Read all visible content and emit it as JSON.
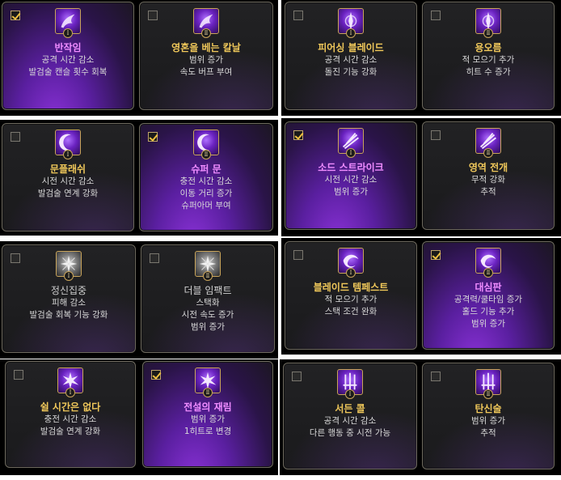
{
  "cards": [
    {
      "title": "반작임",
      "lines": [
        "공격 시간 감소",
        "발검술 캔슬 횟수 회복"
      ],
      "rank": "Ⅰ",
      "checked": true,
      "selected": true,
      "icon": "purple-wing-icon"
    },
    {
      "title": "영혼을 베는 칼날",
      "lines": [
        "범위 증가",
        "속도 버프 부여"
      ],
      "rank": "Ⅱ",
      "checked": false,
      "selected": false,
      "icon": "purple-wing-icon"
    },
    {
      "title": "피어싱 블레이드",
      "lines": [
        "공격 시간 감소",
        "돌진 기능 강화"
      ],
      "rank": "Ⅰ",
      "checked": false,
      "selected": false,
      "icon": "purple-blade-icon"
    },
    {
      "title": "용오름",
      "lines": [
        "적 모으기 추가",
        "히트 수 증가"
      ],
      "rank": "Ⅱ",
      "checked": false,
      "selected": false,
      "icon": "purple-blade-icon"
    },
    {
      "title": "문플래쉬",
      "lines": [
        "시전 시간 감소",
        "발검술 연계 강화"
      ],
      "rank": "Ⅰ",
      "checked": false,
      "selected": false,
      "icon": "crescent-moon-icon"
    },
    {
      "title": "슈퍼 문",
      "lines": [
        "충전 시간 감소",
        "이동 거리 증가",
        "슈퍼아머 부여"
      ],
      "rank": "Ⅱ",
      "checked": true,
      "selected": true,
      "icon": "crescent-moon-icon"
    },
    {
      "title": "소드 스트라이크",
      "lines": [
        "시전 시간 감소",
        "범위 증가"
      ],
      "rank": "Ⅰ",
      "checked": true,
      "selected": true,
      "icon": "sword-strike-icon"
    },
    {
      "title": "영역 전개",
      "lines": [
        "무적 강화",
        "추적"
      ],
      "rank": "Ⅱ",
      "checked": false,
      "selected": false,
      "icon": "sword-strike-icon"
    },
    {
      "title": "정신집중",
      "lines": [
        "피해 감소",
        "발검술 회복 기능 강화"
      ],
      "rank": "Ⅰ",
      "checked": false,
      "selected": false,
      "icon": "grey-star-icon"
    },
    {
      "title": "더블 임팩트",
      "lines": [
        "스택화",
        "시전 속도 증가",
        "범위 증가"
      ],
      "rank": "Ⅱ",
      "checked": false,
      "selected": false,
      "icon": "grey-star-icon"
    },
    {
      "title": "블레이드 템페스트",
      "lines": [
        "적 모으기 추가",
        "스택 조건 완화"
      ],
      "rank": "Ⅰ",
      "checked": false,
      "selected": false,
      "icon": "purple-tempest-icon"
    },
    {
      "title": "대심판",
      "lines": [
        "공격력/쿨타임 증가",
        "홀드 기능 추가",
        "범위 증가"
      ],
      "rank": "Ⅱ",
      "checked": true,
      "selected": true,
      "icon": "purple-tempest-icon"
    },
    {
      "title": "쉴 시간은 없다",
      "lines": [
        "충전 시간 감소",
        "발검술 연계 강화"
      ],
      "rank": "Ⅰ",
      "checked": false,
      "selected": false,
      "icon": "purple-burst-icon"
    },
    {
      "title": "전설의 재림",
      "lines": [
        "범위 증가",
        "1히트로 변경"
      ],
      "rank": "Ⅱ",
      "checked": true,
      "selected": true,
      "icon": "purple-burst-icon"
    },
    {
      "title": "서든 콜",
      "lines": [
        "공격 시간 감소",
        "다른 행동 중 시전 가능"
      ],
      "rank": "Ⅰ",
      "checked": false,
      "selected": false,
      "icon": "triple-sword-icon"
    },
    {
      "title": "탄신술",
      "lines": [
        "범위 증가",
        "추적"
      ],
      "rank": "Ⅱ",
      "checked": false,
      "selected": false,
      "icon": "triple-sword-icon"
    }
  ]
}
